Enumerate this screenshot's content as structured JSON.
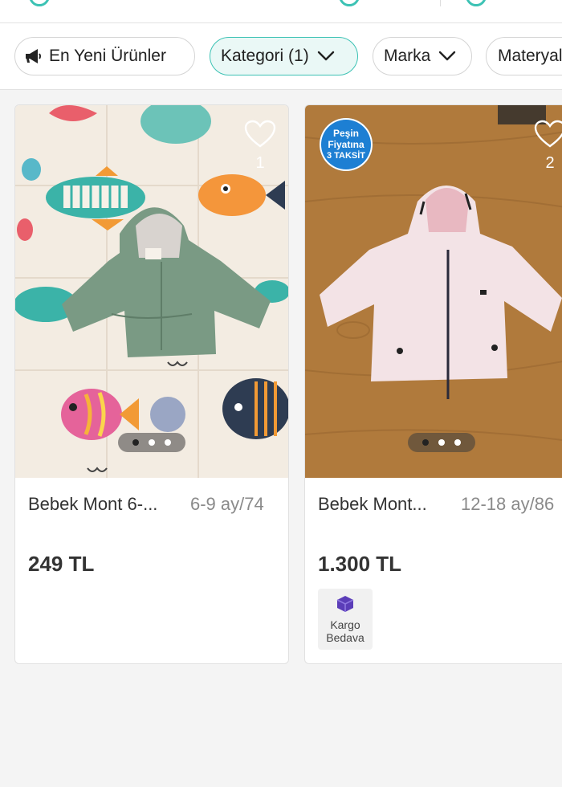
{
  "filters": [
    {
      "label": "En Yeni Ürünler",
      "icon": "megaphone-icon",
      "active": false
    },
    {
      "label": "Kategori (1)",
      "icon": "chevron-down-icon",
      "active": true
    },
    {
      "label": "Marka",
      "icon": "chevron-down-icon",
      "active": false
    },
    {
      "label": "Materyal",
      "icon": "",
      "active": false
    }
  ],
  "products": [
    {
      "name": "Bebek Mont 6-...",
      "size": "6-9 ay/74",
      "price": "249 TL",
      "favorites": "1",
      "image_count": 3,
      "current_image": 1,
      "shipping": ""
    },
    {
      "name": "Bebek Mont...",
      "size": "12-18 ay/86",
      "price": "1.300 TL",
      "favorites": "2",
      "image_count": 3,
      "current_image": 1,
      "badge": {
        "line1": "Peşin",
        "line2": "Fiyatına",
        "line3": "3 TAKSİT"
      },
      "shipping": {
        "line1": "Kargo",
        "line2": "Bedava"
      }
    }
  ],
  "colors": {
    "accent": "#3cc2b4",
    "chip_active_bg": "#eaf8f6",
    "badge_blue": "#1d7fd3",
    "kargo_icon": "#5b3db8"
  }
}
